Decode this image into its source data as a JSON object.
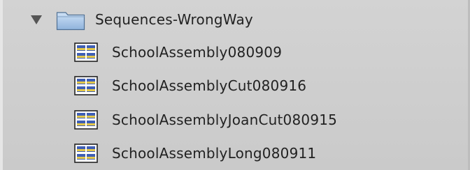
{
  "browser": {
    "folder": {
      "label": "Sequences-WrongWay",
      "expanded": true,
      "icon": "folder-icon"
    },
    "items": [
      {
        "label": "SchoolAssembly080909",
        "icon": "sequence-icon"
      },
      {
        "label": "SchoolAssemblyCut080916",
        "icon": "sequence-icon"
      },
      {
        "label": "SchoolAssemblyJoanCut080915",
        "icon": "sequence-icon"
      },
      {
        "label": "SchoolAssemblyLong080911",
        "icon": "sequence-icon"
      }
    ]
  }
}
